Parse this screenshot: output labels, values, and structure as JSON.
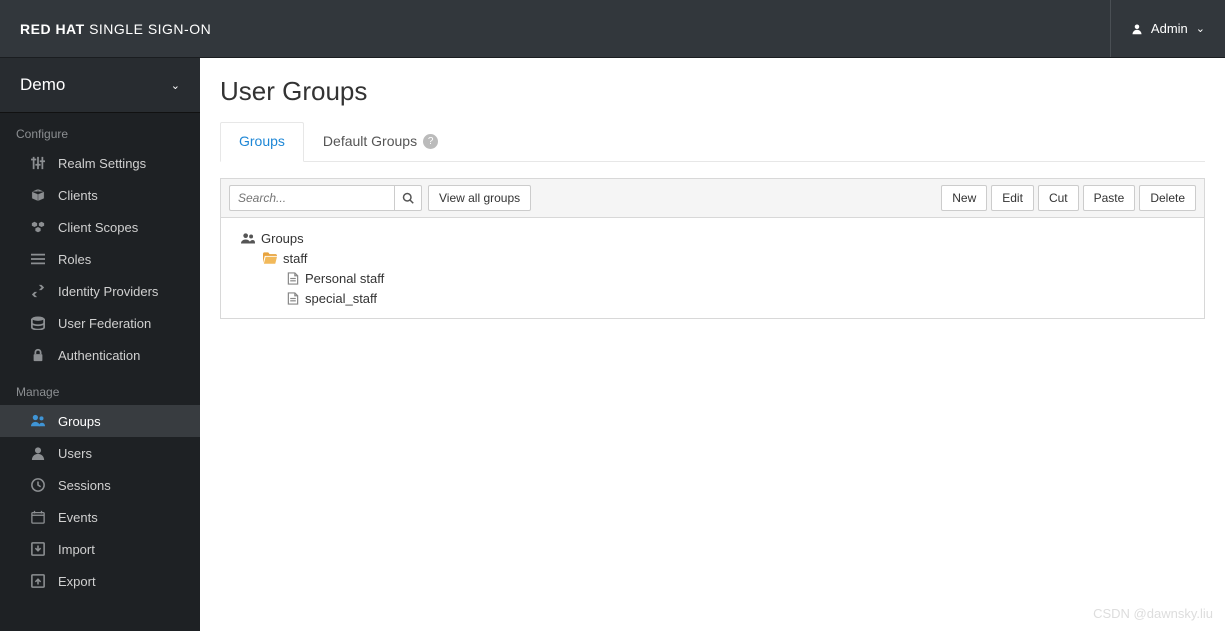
{
  "brand": {
    "bold": "RED HAT",
    "rest": " SINGLE SIGN-ON"
  },
  "user": {
    "name": "Admin"
  },
  "realm": {
    "name": "Demo"
  },
  "sidebar": {
    "sections": [
      {
        "title": "Configure",
        "items": [
          {
            "icon": "sliders",
            "label": "Realm Settings"
          },
          {
            "icon": "cube",
            "label": "Clients"
          },
          {
            "icon": "cubes",
            "label": "Client Scopes"
          },
          {
            "icon": "list",
            "label": "Roles"
          },
          {
            "icon": "exchange",
            "label": "Identity Providers"
          },
          {
            "icon": "database",
            "label": "User Federation"
          },
          {
            "icon": "lock",
            "label": "Authentication"
          }
        ]
      },
      {
        "title": "Manage",
        "items": [
          {
            "icon": "users",
            "label": "Groups",
            "active": true
          },
          {
            "icon": "user",
            "label": "Users"
          },
          {
            "icon": "clock",
            "label": "Sessions"
          },
          {
            "icon": "calendar",
            "label": "Events"
          },
          {
            "icon": "import",
            "label": "Import"
          },
          {
            "icon": "export",
            "label": "Export"
          }
        ]
      }
    ]
  },
  "page": {
    "title": "User Groups"
  },
  "tabs": [
    {
      "label": "Groups",
      "active": true
    },
    {
      "label": "Default Groups",
      "help": true
    }
  ],
  "toolbar": {
    "search_placeholder": "Search...",
    "view_all": "View all groups",
    "buttons": [
      "New",
      "Edit",
      "Cut",
      "Paste",
      "Delete"
    ]
  },
  "tree": {
    "root": "Groups",
    "nodes": [
      {
        "label": "staff",
        "type": "folder",
        "children": [
          {
            "label": "Personal staff",
            "type": "file"
          },
          {
            "label": "special_staff",
            "type": "file"
          }
        ]
      }
    ]
  },
  "watermark": "CSDN @dawnsky.liu"
}
